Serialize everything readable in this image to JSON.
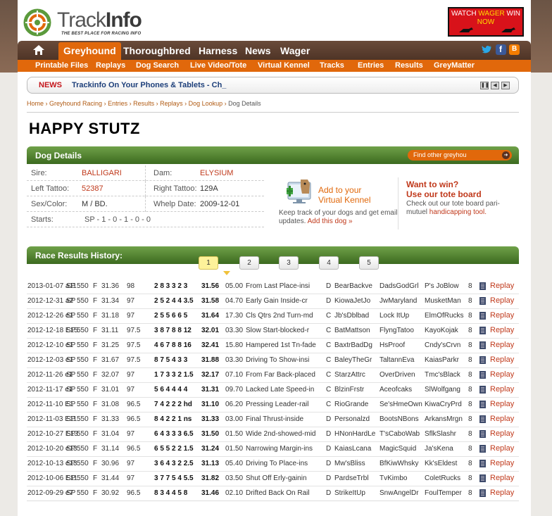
{
  "header": {
    "logo_part1": "Track",
    "logo_part2": "Info",
    "tagline": "THE BEST PLACE FOR RACING INFO",
    "banner_line1a": "WATCH ",
    "banner_wager": "WAGER",
    "banner_line1b": " WIN",
    "banner_now": "NOW"
  },
  "nav": {
    "items": [
      "Greyhound",
      "Thoroughbred",
      "Harness",
      "News",
      "Wager"
    ]
  },
  "subnav": {
    "items": [
      "Printable Files",
      "Replays",
      "Dog Search",
      "Live Video/Tote",
      "Virtual Kennel",
      "Tracks",
      "Entries",
      "Results",
      "GreyMatter"
    ]
  },
  "news": {
    "label": "NEWS",
    "text": "Trackinfo On Your Phones & Tablets - Ch_"
  },
  "breadcrumb": [
    "Home",
    "Greyhound Racing",
    "Entries",
    "Results",
    "Replays",
    "Dog Lookup",
    "Dog Details"
  ],
  "dog_name": "HAPPY STUTZ",
  "dog_details": {
    "title": "Dog Details",
    "find_placeholder": "Find other greyhou",
    "sire_label": "Sire:",
    "sire": "BALLIGARI",
    "dam_label": "Dam:",
    "dam": "ELYSIUM",
    "left_tattoo_label": "Left Tattoo:",
    "left_tattoo": "52387",
    "right_tattoo_label": "Right Tattoo:",
    "right_tattoo": "129A",
    "sex_color_label": "Sex/Color:",
    "sex_color": "M / BD.",
    "whelp_label": "Whelp Date:",
    "whelp_date": "2009-12-01",
    "starts_label": "Starts:",
    "starts": "SP - 1 - 0 - 1 - 0 - 0"
  },
  "kennel": {
    "title_line1": "Add to your",
    "title_line2": "Virtual Kennel",
    "text": "Keep track of your dogs and get email updates. ",
    "link": "Add this dog »"
  },
  "win": {
    "line1": "Want to win?",
    "line2": "Use our tote board",
    "text": "Check out our tote board pari-mutuel ",
    "link": "handicapping tool."
  },
  "results": {
    "title": "Race Results History:",
    "pages": [
      "1",
      "2",
      "3",
      "4",
      "5"
    ],
    "active_page": "1",
    "replay_label": "Replay",
    "rows": [
      [
        "2013-01-07 a11",
        "SP",
        "550",
        "F",
        "31.36",
        "98",
        "2 8 3 3 2 3",
        "31.56",
        "05.00",
        "From Last Place-insi",
        "D",
        "BearBackve",
        "DadsGodGrl",
        "P's JoBlow",
        "8"
      ],
      [
        "2012-12-31 a2",
        "SP",
        "550",
        "F",
        "31.34",
        "97",
        "2 5 2 4 4 3.5",
        "31.58",
        "04.70",
        "Early Gain Inside-cr",
        "D",
        "KiowaJetJo",
        "JwMaryland",
        "MusketMan",
        "8"
      ],
      [
        "2012-12-26 e1",
        "SP",
        "550",
        "F",
        "31.18",
        "97",
        "2 5 5 6 6 5",
        "31.64",
        "17.30",
        "Cls Qtrs 2nd Turn-md",
        "C",
        "Jb'sDblbad",
        "Lock ItUp",
        "ElmOfRucks",
        "8"
      ],
      [
        "2012-12-18 E15",
        "SP",
        "550",
        "F",
        "31.11",
        "97.5",
        "3 8 7 8 8 12",
        "32.01",
        "03.30",
        "Slow Start-blocked-r",
        "C",
        "BatMattson",
        "FlyngTatoo",
        "KayoKojak",
        "8"
      ],
      [
        "2012-12-10 e1",
        "SP",
        "550",
        "F",
        "31.25",
        "97.5",
        "4 6 7 8 8 16",
        "32.41",
        "15.80",
        "Hampered 1st Tn-fade",
        "C",
        "BaxtrBadDg",
        "HsProof",
        "Cndy'sCrvn",
        "8"
      ],
      [
        "2012-12-03 e1",
        "SP",
        "550",
        "F",
        "31.67",
        "97.5",
        "8 7 5 4 3 3",
        "31.88",
        "03.30",
        "Driving To Show-insi",
        "C",
        "BaleyTheGr",
        "TaltannEva",
        "KaiasParkr",
        "8"
      ],
      [
        "2012-11-26 e1",
        "SP",
        "550",
        "F",
        "32.07",
        "97",
        "1 7 3 3 2 1.5",
        "32.17",
        "07.10",
        "From Far Back-placed",
        "C",
        "StarzAttrc",
        "OverDriven",
        "Tmc'sBlack",
        "8"
      ],
      [
        "2012-11-17 e1",
        "SP",
        "550",
        "F",
        "31.01",
        "97",
        "5 6 4 4 4 4",
        "31.31",
        "09.70",
        "Lacked Late Speed-in",
        "C",
        "BlzinFrstr",
        "Aceofcaks",
        "SlWolfgang",
        "8"
      ],
      [
        "2012-11-10 E1",
        "SP",
        "550",
        "F",
        "31.08",
        "96.5",
        "7 4 2 2 2 hd",
        "31.10",
        "06.20",
        "Pressing Leader-rail",
        "C",
        "RioGrande",
        "Se'sHmeOwn",
        "KiwaCryPrd",
        "8"
      ],
      [
        "2012-11-03 E11",
        "SP",
        "550",
        "F",
        "31.33",
        "96.5",
        "8 4 2 2 1 ns",
        "31.33",
        "03.00",
        "Final Thrust-inside",
        "D",
        "Personalzd",
        "BootsNBons",
        "ArkansMrgn",
        "8"
      ],
      [
        "2012-10-27 E13",
        "SP",
        "550",
        "F",
        "31.04",
        "97",
        "6 4 3 3 3 6.5",
        "31.50",
        "01.50",
        "Wide 2nd-showed-mid",
        "D",
        "HNonHardLe",
        "T'sCaboWab",
        "SflkSlashr",
        "8"
      ],
      [
        "2012-10-20 e13",
        "SP",
        "550",
        "F",
        "31.14",
        "96.5",
        "6 5 5 2 2 1.5",
        "31.24",
        "01.50",
        "Narrowing Margin-ins",
        "D",
        "KaiasLcana",
        "MagicSquid",
        "Ja'sKena",
        "8"
      ],
      [
        "2012-10-13 e13",
        "SP",
        "550",
        "F",
        "30.96",
        "97",
        "3 6 4 3 2 2.5",
        "31.13",
        "05.40",
        "Driving To Place-ins",
        "D",
        "Mw'sBliss",
        "BfKiwWhsky",
        "Kk'sEldest",
        "8"
      ],
      [
        "2012-10-06 E11",
        "SP",
        "550",
        "F",
        "31.44",
        "97",
        "3 7 7 5 4 5.5",
        "31.82",
        "03.50",
        "Shut Off Erly-gainin",
        "D",
        "PardseTrbl",
        "TvKimbo",
        "ColetRucks",
        "8"
      ],
      [
        "2012-09-29 e7",
        "SP",
        "550",
        "F",
        "30.92",
        "96.5",
        "8 3 4 4 5 8",
        "31.46",
        "02.10",
        "Drifted Back On Rail",
        "D",
        "StrikeItUp",
        "SnwAngelDr",
        "FoulTemper",
        "8"
      ]
    ]
  },
  "colors": {
    "brand_orange": "#e1680b",
    "nav_brown": "#5a3d2e",
    "section_green": "#4f7f2f",
    "link_red": "#c0391b"
  }
}
